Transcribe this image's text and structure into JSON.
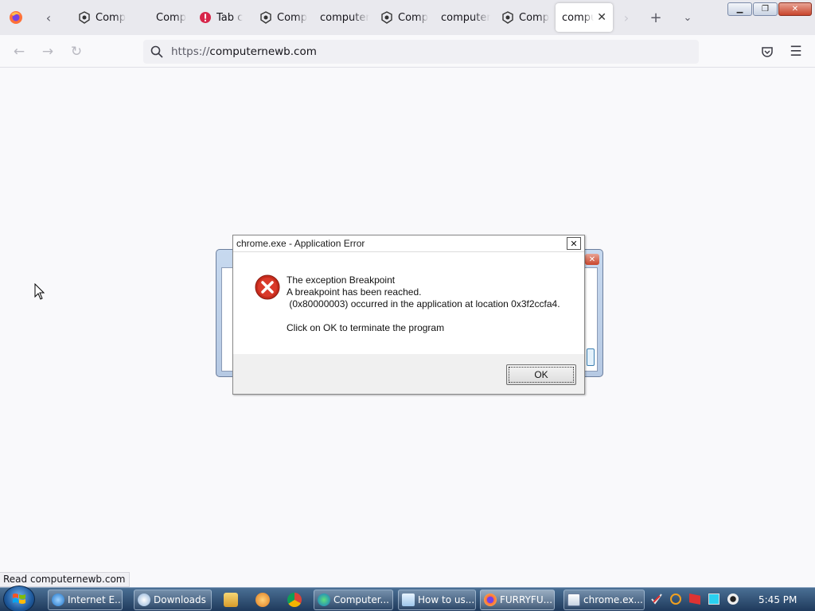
{
  "browser": {
    "tabs": [
      {
        "label": "Comp",
        "icon": "computernewb-icon"
      },
      {
        "label": "Comp",
        "icon": "none"
      },
      {
        "label": "Tab c",
        "icon": "warning-icon"
      },
      {
        "label": "Comp",
        "icon": "computernewb-icon"
      },
      {
        "label": "computer",
        "icon": "none"
      },
      {
        "label": "Comp",
        "icon": "computernewb-icon"
      },
      {
        "label": "computer",
        "icon": "none"
      },
      {
        "label": "Comp",
        "icon": "computernewb-icon"
      },
      {
        "label": "compute",
        "icon": "none",
        "active": true
      }
    ],
    "url": {
      "scheme": "https://",
      "host": "computernewb.com"
    },
    "status_text": "Read computernewb.com"
  },
  "dialog": {
    "title": "chrome.exe - Application Error",
    "lines": [
      "The exception Breakpoint",
      "A breakpoint has been reached.",
      " (0x80000003) occurred in the application at location 0x3f2ccfa4.",
      "",
      "Click on OK to terminate the program"
    ],
    "ok_label": "OK",
    "close_label": "✕"
  },
  "taskbar": {
    "buttons": [
      {
        "label": "Internet E...",
        "icon": "internet-explorer-icon"
      },
      {
        "label": "Downloads",
        "icon": "downloads-icon"
      },
      {
        "label": "Computer...",
        "icon": "edge-icon"
      },
      {
        "label": "How to us...",
        "icon": "notepad-icon"
      },
      {
        "label": "FURRYFU...",
        "icon": "firefox-icon",
        "active": true
      },
      {
        "label": "chrome.ex...",
        "icon": "window-icon"
      }
    ],
    "clock": "5:45 PM"
  },
  "colors": {
    "accent": "#0060df",
    "error_red": "#c42b1c",
    "taskbar": "#2c4c70"
  }
}
